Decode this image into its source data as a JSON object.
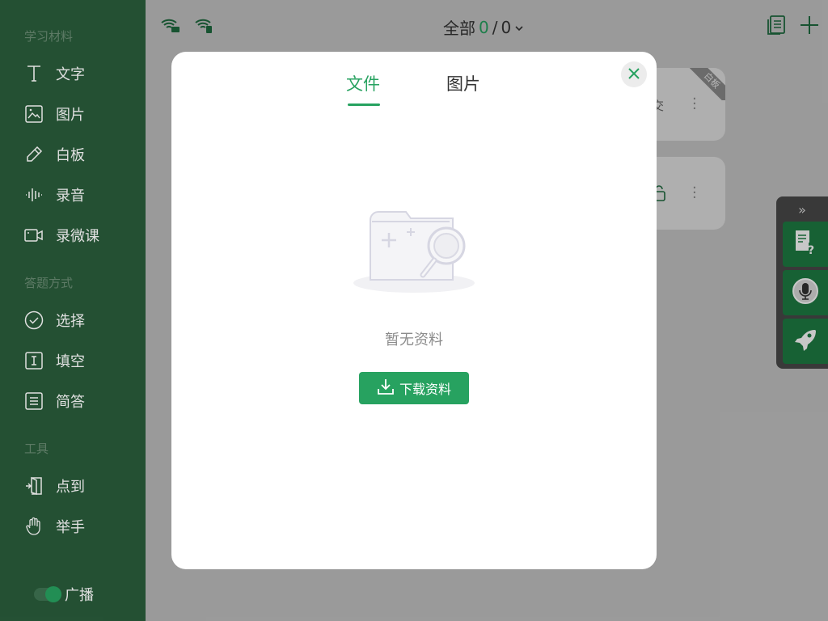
{
  "sidebar": {
    "sections": [
      {
        "label": "学习材料"
      },
      {
        "label": "答题方式"
      },
      {
        "label": "工具"
      }
    ],
    "items": [
      {
        "label": "文字",
        "icon": "text-icon"
      },
      {
        "label": "图片",
        "icon": "image-icon"
      },
      {
        "label": "白板",
        "icon": "pencil-icon"
      },
      {
        "label": "录音",
        "icon": "waveform-icon"
      },
      {
        "label": "录微课",
        "icon": "video-camera-icon"
      },
      {
        "label": "选择",
        "icon": "check-circle-icon"
      },
      {
        "label": "填空",
        "icon": "text-cursor-box-icon"
      },
      {
        "label": "简答",
        "icon": "list-box-icon"
      },
      {
        "label": "点到",
        "icon": "door-icon"
      },
      {
        "label": "举手",
        "icon": "hand-icon"
      }
    ],
    "broadcast_label": "广播",
    "broadcast_on": true
  },
  "topbar": {
    "title_prefix": "全部",
    "current": "0",
    "separator": "/",
    "total": "0"
  },
  "cards": [
    {
      "badge": "白板",
      "partial_text": "交"
    },
    {
      "badge": ""
    }
  ],
  "dialog": {
    "tabs": [
      {
        "label": "文件",
        "active": true
      },
      {
        "label": "图片",
        "active": false
      }
    ],
    "empty_text": "暂无资料",
    "download_label": "下载资料"
  },
  "colors": {
    "brand_green": "#27a260",
    "sidebar_bg": "#2a5c3b"
  }
}
